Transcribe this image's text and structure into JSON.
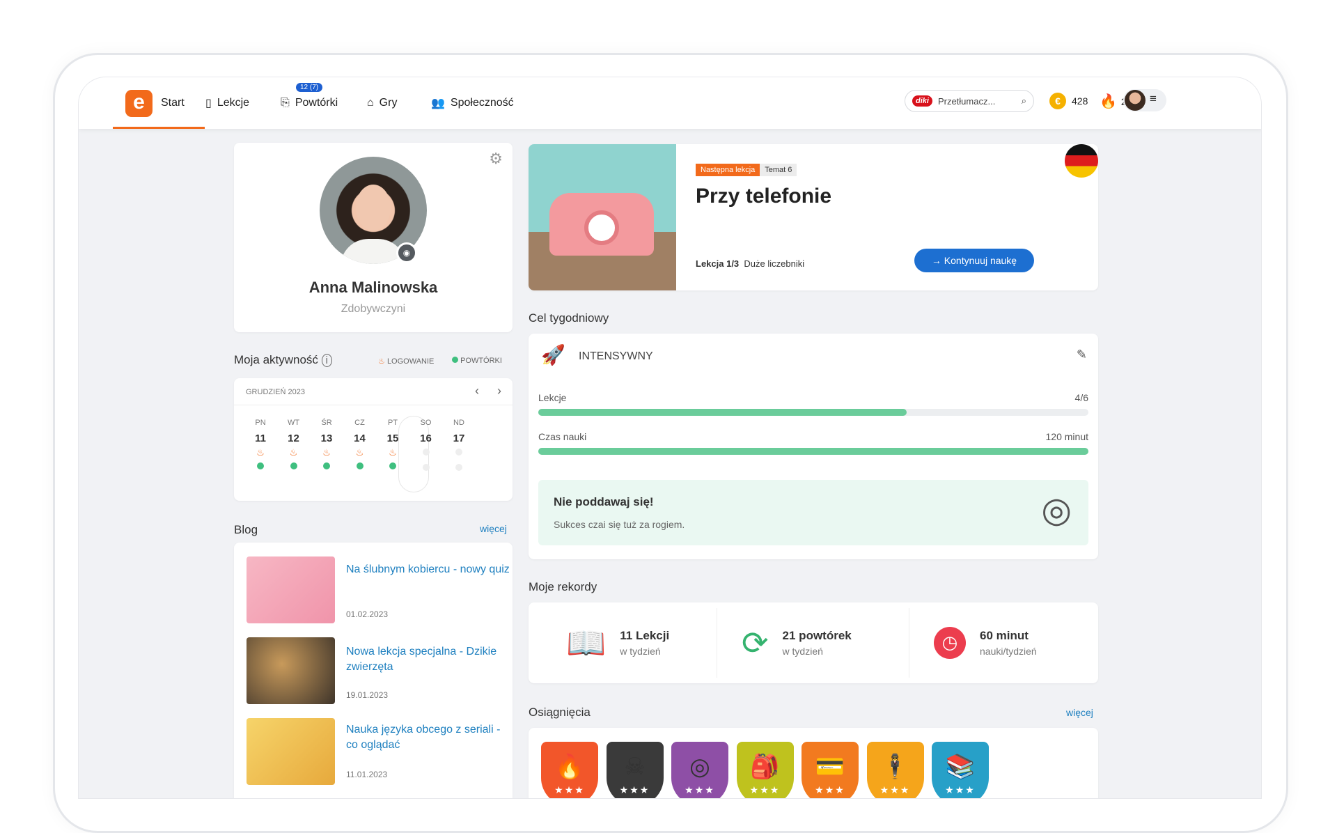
{
  "nav": {
    "logo": "e",
    "items": [
      {
        "label": "Start",
        "icon": "home-logo"
      },
      {
        "label": "Lekcje",
        "icon": "book-icon"
      },
      {
        "label": "Powtórki",
        "icon": "repeat-icon",
        "badge": "12 (7)"
      },
      {
        "label": "Gry",
        "icon": "gamepad-icon"
      },
      {
        "label": "Społeczność",
        "icon": "people-icon"
      }
    ],
    "search_brand": "diki",
    "search_placeholder": "Przetłumacz...",
    "coins": "428",
    "streak": "22"
  },
  "profile": {
    "name": "Anna Malinowska",
    "title": "Zdobywczyni"
  },
  "activity": {
    "title": "Moja aktywność",
    "legend_login": "LOGOWANIE",
    "legend_reviews": "POWTÓRKI",
    "month": "GRUDZIEŃ 2023",
    "days": [
      {
        "name": "PN",
        "num": "11",
        "login": true,
        "review": true
      },
      {
        "name": "WT",
        "num": "12",
        "login": true,
        "review": true
      },
      {
        "name": "ŚR",
        "num": "13",
        "login": true,
        "review": true
      },
      {
        "name": "CZ",
        "num": "14",
        "login": true,
        "review": true
      },
      {
        "name": "PT",
        "num": "15",
        "login": true,
        "review": true,
        "today": true
      },
      {
        "name": "SO",
        "num": "16",
        "login": false,
        "review": false
      },
      {
        "name": "ND",
        "num": "17",
        "login": false,
        "review": false
      }
    ]
  },
  "blog": {
    "title": "Blog",
    "more": "więcej",
    "posts": [
      {
        "title": "Na ślubnym kobiercu - nowy quiz",
        "date": "01.02.2023",
        "color": "#f2a7b8"
      },
      {
        "title": "Nowa lekcja specjalna - Dzikie zwierzęta",
        "date": "19.01.2023",
        "color": "#7a6a52"
      },
      {
        "title": "Nauka języka obcego z seriali - co oglądać",
        "date": "11.01.2023",
        "color": "#f0c45c"
      }
    ]
  },
  "next_lesson": {
    "tag": "Następna lekcja",
    "topic": "Temat 6",
    "title": "Przy telefonie",
    "lesson": "Lekcja 1/3",
    "lesson_name": "Duże liczebniki",
    "button": "Kontynuuj naukę"
  },
  "weekly_goal": {
    "title": "Cel tygodniowy",
    "level": "INTENSYWNY",
    "rows": [
      {
        "label": "Lekcje",
        "value": "4/6",
        "progress": 0.67
      },
      {
        "label": "Czas nauki",
        "value": "120 minut",
        "progress": 1.0
      }
    ],
    "tip_title": "Nie poddawaj się!",
    "tip_text": "Sukces czai się tuż za rogiem."
  },
  "records": {
    "title": "Moje rekordy",
    "items": [
      {
        "value": "11 Lekcji",
        "sub": "w tydzień",
        "icon": "open-book-icon"
      },
      {
        "value": "21 powtórek",
        "sub": "w tydzień",
        "icon": "repeat-arrows-icon"
      },
      {
        "value": "60 minut",
        "sub": "nauki/tydzień",
        "icon": "clock-icon"
      }
    ]
  },
  "achievements": {
    "title": "Osiągnięcia",
    "more": "więcej",
    "badges": [
      {
        "icon": "🔥",
        "color": "#f2562a"
      },
      {
        "icon": "☠",
        "color": "#3a3a3a"
      },
      {
        "icon": "◎",
        "color": "#8e4fa6"
      },
      {
        "icon": "🎒",
        "color": "#bfc21e"
      },
      {
        "icon": "💳",
        "color": "#f27a1f"
      },
      {
        "icon": "🕴",
        "color": "#f5a51b"
      },
      {
        "icon": "📚",
        "color": "#27a0c8"
      }
    ]
  }
}
